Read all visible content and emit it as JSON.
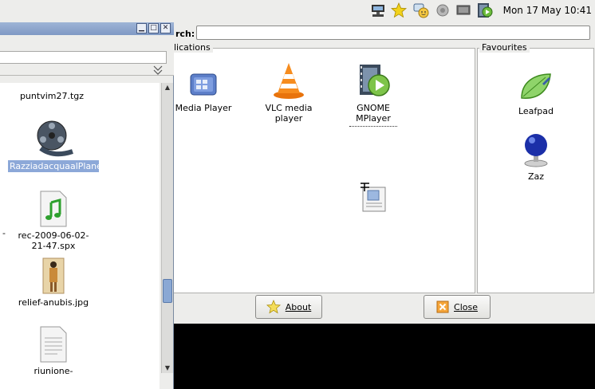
{
  "top_panel": {
    "clock": "Mon 17 May 10:41",
    "tray_icons": [
      "network-icon",
      "star-icon",
      "messenger-icon",
      "sound-icon",
      "display-icon",
      "media-player-icon"
    ]
  },
  "launcher": {
    "search_label": "rch:",
    "search_value": "",
    "applications_label": "lications",
    "favourites_label": "Favourites",
    "applications": [
      {
        "name": "Media Player",
        "icon": "media-player-icon"
      },
      {
        "name": "VLC media player",
        "icon": "vlc-cone-icon"
      },
      {
        "name": "GNOME MPlayer",
        "icon": "gnome-mplayer-icon"
      }
    ],
    "favourites": [
      {
        "name": "Leafpad",
        "icon": "leafpad-icon"
      },
      {
        "name": "Zaz",
        "icon": "zaz-icon"
      }
    ],
    "about_label": "About",
    "close_label": "Close",
    "colors": {
      "panel_bg": "#ededeb",
      "frame_border": "#b0b0ae"
    }
  },
  "file_manager": {
    "files": [
      {
        "name": "puntvim27.tgz",
        "icon": "archive-icon"
      },
      {
        "name": "RazziadacquaalPlanetario.flv",
        "icon": "film-reel-icon",
        "selected": true
      },
      {
        "name": "rec-2009-06-02-21-47.spx",
        "icon": "audio-file-icon"
      },
      {
        "name": "relief-anubis.jpg",
        "icon": "image-thumbnail-icon"
      },
      {
        "name": "riunione-",
        "icon": "text-document-icon"
      }
    ],
    "left_cut_marker": "-",
    "colors": {
      "titlebar": "#8aa3cc",
      "selection": "#8ca8d8"
    }
  }
}
